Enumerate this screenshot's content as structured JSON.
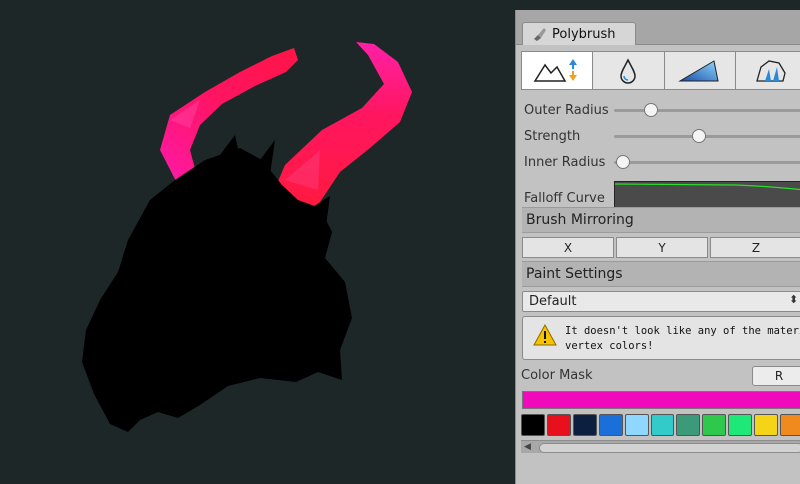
{
  "panel": {
    "tab_label": "Polybrush",
    "tools": [
      {
        "icon": "raise-lower-terrain-icon"
      },
      {
        "icon": "smooth-water-drop-icon"
      },
      {
        "icon": "paint-triangle-icon"
      },
      {
        "icon": "prefab-crystal-icon"
      }
    ],
    "sliders": [
      {
        "label": "Outer Radius",
        "level": 0.18
      },
      {
        "label": "Strength",
        "level": 0.42
      },
      {
        "label": "Inner Radius",
        "level": 0.04
      }
    ],
    "falloff_label": "Falloff Curve",
    "brush_mirroring": {
      "title": "Brush Mirroring",
      "axes": [
        "X",
        "Y",
        "Z"
      ]
    },
    "paint_settings": {
      "title": "Paint Settings",
      "selected": "Default",
      "arrow": "⬍"
    },
    "warning": {
      "line1": "It doesn't look like any of the materials o",
      "line2": "vertex colors!"
    },
    "color_mask": {
      "label": "Color Mask",
      "channel": "R"
    },
    "current_color": "#f00abc",
    "palette": [
      "#000000",
      "#e8101c",
      "#0c1f3f",
      "#1a6fd8",
      "#8fd7ff",
      "#33cbc9",
      "#3b9a7a",
      "#2ec84c",
      "#1ee878",
      "#f5d316",
      "#f08a1e"
    ]
  }
}
